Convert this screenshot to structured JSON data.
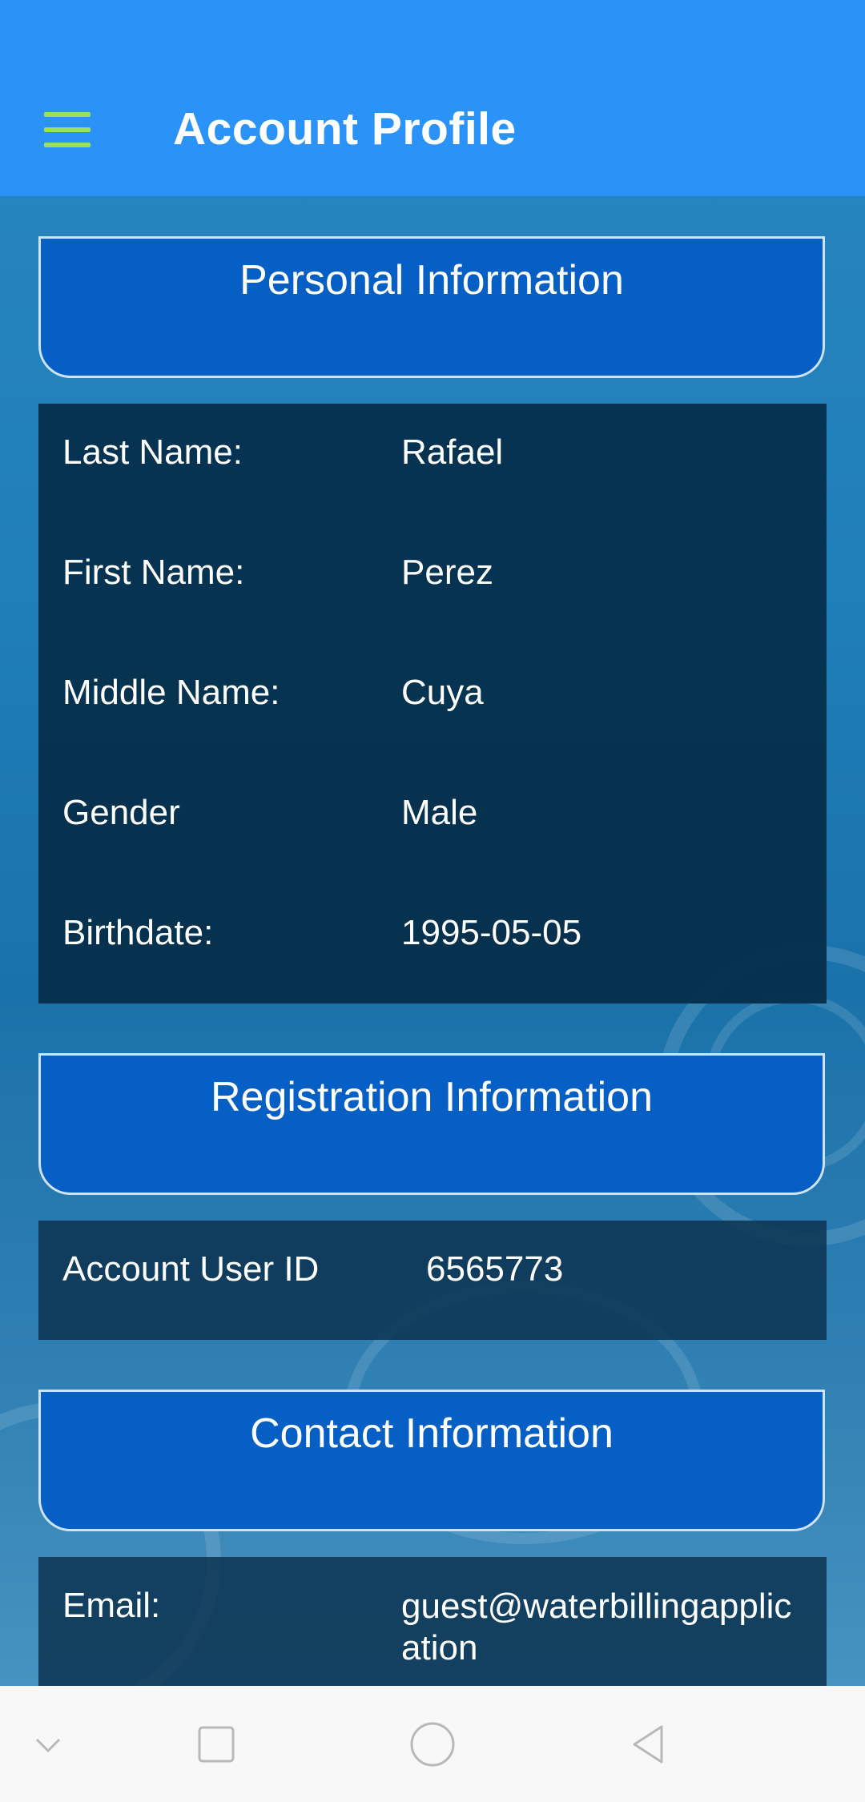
{
  "app_bar": {
    "title": "Account Profile",
    "menu_icon": "hamburger-menu-icon",
    "menu_color": "#9be05a",
    "background": "#2b93f7"
  },
  "sections": {
    "personal": {
      "header": "Personal Information",
      "rows": [
        {
          "label": "Last Name:",
          "value": "Rafael"
        },
        {
          "label": "First Name:",
          "value": "Perez"
        },
        {
          "label": "Middle Name:",
          "value": "Cuya"
        },
        {
          "label": "Gender",
          "value": "Male"
        },
        {
          "label": "Birthdate:",
          "value": "1995-05-05"
        }
      ]
    },
    "registration": {
      "header": "Registration Information",
      "rows": [
        {
          "label": "Account User ID",
          "value": "6565773"
        }
      ]
    },
    "contact": {
      "header": "Contact Information",
      "rows": [
        {
          "label": "Email:",
          "value": "guest@waterbillingapplication"
        }
      ]
    }
  },
  "nav_bar": {
    "buttons": [
      "chevron-down-icon",
      "recents-square-icon",
      "home-circle-icon",
      "back-triangle-icon"
    ]
  },
  "colors": {
    "section_header": "#065fc4",
    "panel": "#042d48"
  }
}
